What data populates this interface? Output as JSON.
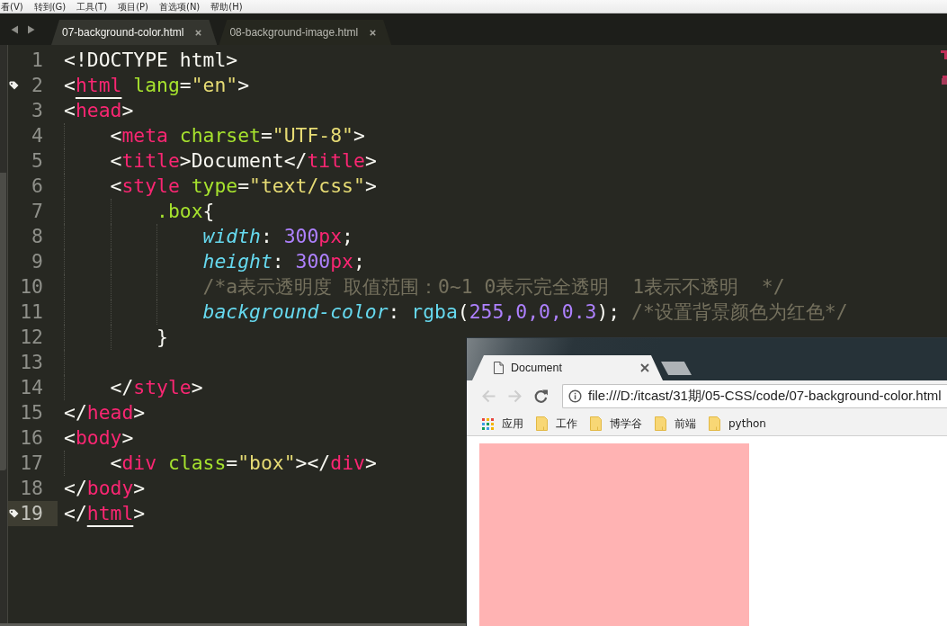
{
  "menu_bar": {
    "items": [
      "看(V)",
      "转到(G)",
      "工具(T)",
      "项目(P)",
      "首选项(N)",
      "帮助(H)"
    ]
  },
  "editor_tabs": [
    {
      "label": "07-background-color.html",
      "selected": true
    },
    {
      "label": "08-background-image.html",
      "selected": false
    }
  ],
  "code_lines": [
    {
      "number": "1",
      "bookmarked": false,
      "current": false,
      "tokens": [
        {
          "kind": "punct",
          "text": "<!DOCTYPE html>"
        }
      ]
    },
    {
      "number": "2",
      "bookmarked": true,
      "current": false,
      "tokens": [
        {
          "kind": "punct",
          "text": "<"
        },
        {
          "kind": "tag-matched",
          "text": "html"
        },
        {
          "kind": "attr",
          "text": " lang"
        },
        {
          "kind": "punct",
          "text": "="
        },
        {
          "kind": "string",
          "text": "\"en\""
        },
        {
          "kind": "punct",
          "text": ">"
        }
      ]
    },
    {
      "number": "3",
      "bookmarked": false,
      "current": false,
      "tokens": [
        {
          "kind": "punct",
          "text": "<"
        },
        {
          "kind": "tag",
          "text": "head"
        },
        {
          "kind": "punct",
          "text": ">"
        }
      ],
      "children": [
        {
          "number": "4",
          "bookmarked": false,
          "current": false,
          "tokens": [
            {
              "kind": "punct",
              "text": "<"
            },
            {
              "kind": "tag",
              "text": "meta"
            },
            {
              "kind": "attr",
              "text": " charset"
            },
            {
              "kind": "punct",
              "text": "="
            },
            {
              "kind": "string",
              "text": "\"UTF-8\""
            },
            {
              "kind": "punct",
              "text": ">"
            }
          ]
        },
        {
          "number": "5",
          "bookmarked": false,
          "current": false,
          "tokens": [
            {
              "kind": "punct",
              "text": "<"
            },
            {
              "kind": "tag",
              "text": "title"
            },
            {
              "kind": "punct",
              "text": ">"
            },
            {
              "kind": "text",
              "text": "Document"
            },
            {
              "kind": "punct",
              "text": "</"
            },
            {
              "kind": "tag",
              "text": "title"
            },
            {
              "kind": "punct",
              "text": ">"
            }
          ]
        },
        {
          "number": "6",
          "bookmarked": false,
          "current": false,
          "tokens": [
            {
              "kind": "punct",
              "text": "<"
            },
            {
              "kind": "tag",
              "text": "style"
            },
            {
              "kind": "attr",
              "text": " type"
            },
            {
              "kind": "punct",
              "text": "="
            },
            {
              "kind": "string",
              "text": "\"text/css\""
            },
            {
              "kind": "punct",
              "text": ">"
            }
          ],
          "children": [
            {
              "number": "7",
              "bookmarked": false,
              "current": false,
              "tokens": [
                {
                  "kind": "selector",
                  "text": ".box"
                },
                {
                  "kind": "punct",
                  "text": "{"
                }
              ],
              "children": [
                {
                  "number": "8",
                  "bookmarked": false,
                  "current": false,
                  "tokens": [
                    {
                      "kind": "property",
                      "text": "width"
                    },
                    {
                      "kind": "punct",
                      "text": ": "
                    },
                    {
                      "kind": "number",
                      "text": "300"
                    },
                    {
                      "kind": "unit",
                      "text": "px"
                    },
                    {
                      "kind": "punct",
                      "text": ";"
                    }
                  ]
                },
                {
                  "number": "9",
                  "bookmarked": false,
                  "current": false,
                  "tokens": [
                    {
                      "kind": "property",
                      "text": "height"
                    },
                    {
                      "kind": "punct",
                      "text": ": "
                    },
                    {
                      "kind": "number",
                      "text": "300"
                    },
                    {
                      "kind": "unit",
                      "text": "px"
                    },
                    {
                      "kind": "punct",
                      "text": ";"
                    }
                  ]
                },
                {
                  "number": "10",
                  "bookmarked": false,
                  "current": false,
                  "tokens": [
                    {
                      "kind": "comment",
                      "text": "/*a表示透明度 取值范围：0~1 0表示完全透明  1表示不透明  */"
                    }
                  ]
                },
                {
                  "number": "11",
                  "bookmarked": false,
                  "current": false,
                  "tokens": [
                    {
                      "kind": "property",
                      "text": "background-color"
                    },
                    {
                      "kind": "punct",
                      "text": ": "
                    },
                    {
                      "kind": "func",
                      "text": "rgba"
                    },
                    {
                      "kind": "punct",
                      "text": "("
                    },
                    {
                      "kind": "number",
                      "text": "255,0,0,0.3"
                    },
                    {
                      "kind": "punct",
                      "text": "); "
                    },
                    {
                      "kind": "comment",
                      "text": "/*设置背景颜色为红色*/"
                    }
                  ]
                }
              ]
            },
            {
              "number": "12",
              "bookmarked": false,
              "current": false,
              "tokens": [
                {
                  "kind": "punct",
                  "text": "}"
                }
              ]
            }
          ]
        },
        {
          "number": "13",
          "bookmarked": false,
          "current": false
        },
        {
          "number": "14",
          "bookmarked": false,
          "current": false,
          "tokens": [
            {
              "kind": "punct",
              "text": "</"
            },
            {
              "kind": "tag",
              "text": "style"
            },
            {
              "kind": "punct",
              "text": ">"
            }
          ]
        }
      ]
    },
    {
      "number": "15",
      "bookmarked": false,
      "current": false,
      "tokens": [
        {
          "kind": "punct",
          "text": "</"
        },
        {
          "kind": "tag",
          "text": "head"
        },
        {
          "kind": "punct",
          "text": ">"
        }
      ]
    },
    {
      "number": "16",
      "bookmarked": false,
      "current": false,
      "tokens": [
        {
          "kind": "punct",
          "text": "<"
        },
        {
          "kind": "tag",
          "text": "body"
        },
        {
          "kind": "punct",
          "text": ">"
        }
      ],
      "children": [
        {
          "number": "17",
          "bookmarked": false,
          "current": false,
          "tokens": [
            {
              "kind": "punct",
              "text": "<"
            },
            {
              "kind": "tag",
              "text": "div"
            },
            {
              "kind": "attr",
              "text": " class"
            },
            {
              "kind": "punct",
              "text": "="
            },
            {
              "kind": "string",
              "text": "\"box\""
            },
            {
              "kind": "punct",
              "text": "></"
            },
            {
              "kind": "tag",
              "text": "div"
            },
            {
              "kind": "punct",
              "text": ">"
            }
          ]
        }
      ]
    },
    {
      "number": "18",
      "bookmarked": false,
      "current": false,
      "tokens": [
        {
          "kind": "punct",
          "text": "</"
        },
        {
          "kind": "tag",
          "text": "body"
        },
        {
          "kind": "punct",
          "text": ">"
        }
      ]
    },
    {
      "number": "19",
      "bookmarked": true,
      "current": true,
      "tokens": [
        {
          "kind": "punct",
          "text": "</"
        },
        {
          "kind": "tag-matched",
          "text": "html"
        },
        {
          "kind": "punct",
          "text": ">"
        }
      ]
    }
  ],
  "browser": {
    "tabs": [
      {
        "title": "Document",
        "selected": true
      }
    ],
    "nav_buttons": [
      {
        "kind": "back",
        "disabled": true
      },
      {
        "kind": "forward",
        "disabled": true
      },
      {
        "kind": "reload",
        "disabled": false
      }
    ],
    "address": "file:///D:/itcast/31期/05-CSS/code/07-background-color.html",
    "bookmarks": [
      {
        "kind": "apps",
        "label": "应用"
      },
      {
        "kind": "folder",
        "label": "工作"
      },
      {
        "kind": "folder",
        "label": "博学谷"
      },
      {
        "kind": "folder",
        "label": "前端"
      },
      {
        "kind": "folder",
        "label": "python"
      }
    ]
  }
}
